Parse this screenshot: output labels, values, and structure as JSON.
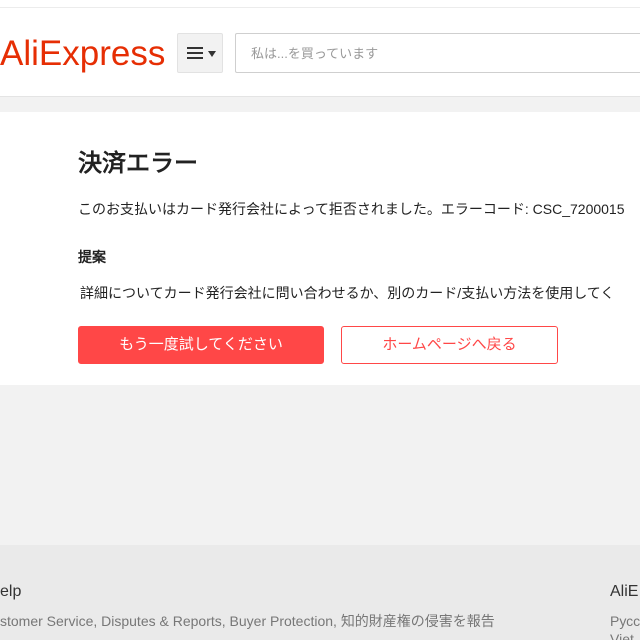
{
  "header": {
    "logo_text": "AliExpress",
    "search_placeholder": "私は...を買っています"
  },
  "icons": {
    "menu": "hamburger-menu-icon",
    "caret": "caret-down-icon"
  },
  "colors": {
    "brand": "#e62e04",
    "accent": "#ff4747",
    "page_background": "#f2f2f2"
  },
  "error_panel": {
    "title": "決済エラー",
    "message": "このお支払いはカード発行会社によって拒否されました。エラーコード: CSC_7200015",
    "suggestion_heading": "提案",
    "suggestion_text": "詳細についてカード発行会社に問い合わせるか、別のカード/支払い方法を使用してく",
    "retry_button": "もう一度試してください",
    "home_button": "ホームページへ戻る"
  },
  "footer": {
    "help_heading": "elp",
    "separator": ", ",
    "help_links": [
      "stomer Service",
      "Disputes & Reports",
      "Buyer Protection",
      "知的財産権の侵害を報告"
    ],
    "sites_heading": "AliE",
    "languages": [
      "Русс",
      "Viet"
    ]
  }
}
